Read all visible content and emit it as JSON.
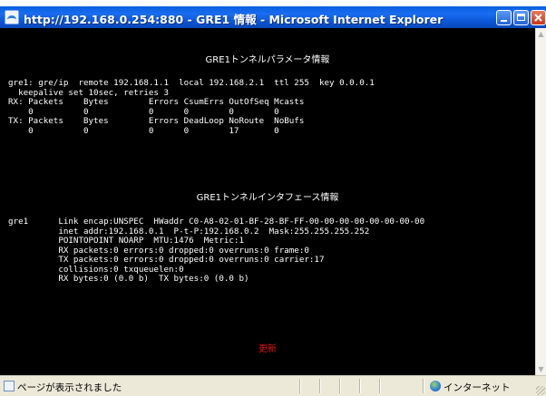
{
  "window": {
    "title": "http://192.168.0.254:880 - GRE1 情報 - Microsoft Internet Explorer",
    "app_icon": "ie-page-icon",
    "buttons": [
      "minimize",
      "maximize",
      "close"
    ]
  },
  "page": {
    "section1_heading": "GRE1トンネルパラメータ情報",
    "section1_lines": [
      "gre1: gre/ip  remote 192.168.1.1  local 192.168.2.1  ttl 255  key 0.0.0.1",
      "  keepalive set 10sec, retries 3",
      "RX: Packets    Bytes        Errors CsumErrs OutOfSeq Mcasts",
      "    0          0            0      0        0        0",
      "TX: Packets    Bytes        Errors DeadLoop NoRoute  NoBufs",
      "    0          0            0      0        17       0"
    ],
    "section2_heading": "GRE1トンネルインタフェース情報",
    "section2_lines": [
      "gre1      Link encap:UNSPEC  HWaddr C0-A8-02-01-BF-28-BF-FF-00-00-00-00-00-00-00-00",
      "          inet addr:192.168.0.1  P-t-P:192.168.0.2  Mask:255.255.255.252",
      "          POINTOPOINT NOARP  MTU:1476  Metric:1",
      "          RX packets:0 errors:0 dropped:0 overruns:0 frame:0",
      "          TX packets:0 errors:0 dropped:0 overruns:0 carrier:17",
      "          collisions:0 txqueuelen:0",
      "          RX bytes:0 (0.0 b)  TX bytes:0 (0.0 b)"
    ],
    "refresh_label": "更新"
  },
  "statusbar": {
    "status_text": "ページが表示されました",
    "zone_text": "インターネット",
    "zone_icon": "internet-globe-icon"
  },
  "colors": {
    "background": "#000000",
    "text": "#ffffff",
    "refresh_link": "#e61010",
    "titlebar": "#0a5fe0"
  }
}
